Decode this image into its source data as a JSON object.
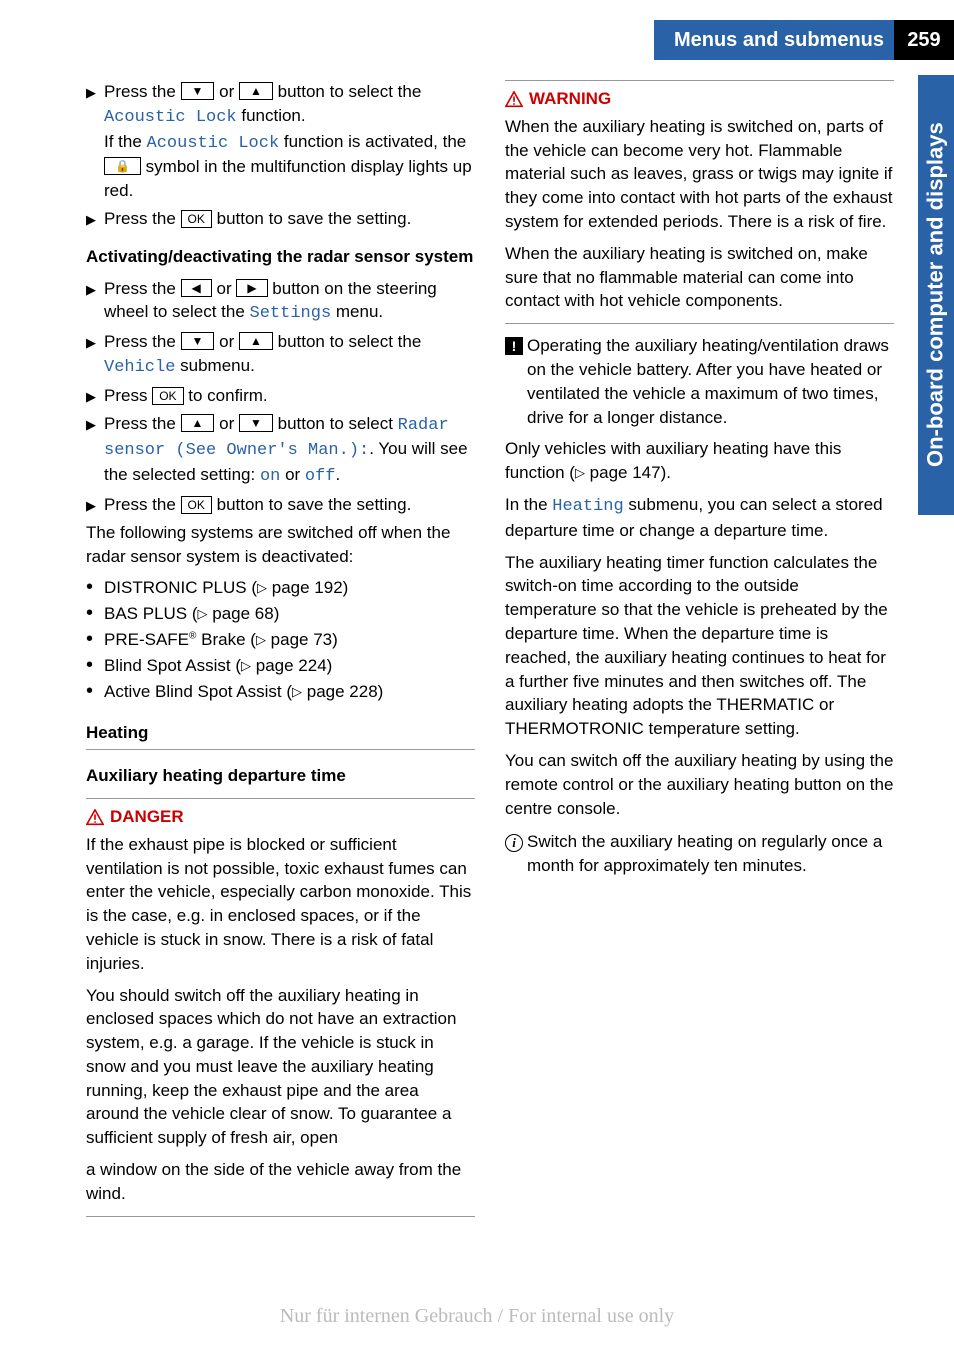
{
  "header": {
    "title": "Menus and submenus",
    "page": "259"
  },
  "sideTab": "On-board computer and displays",
  "buttons": {
    "down": "▼",
    "up": "▲",
    "left": "◀",
    "right": "▶",
    "ok": "OK",
    "lock": "🔒"
  },
  "mono": {
    "acousticLock": "Acoustic Lock",
    "settings": "Settings",
    "vehicle": "Vehicle",
    "radarSensor": "Radar sensor (See Owner's Man.):",
    "on": "on",
    "off": "off",
    "heating": "Heating"
  },
  "left": {
    "s1a": "Press the ",
    "s1b": " or ",
    "s1c": " button to select the ",
    "s1d": " function.",
    "s2a": "If the ",
    "s2b": " function is activated, the ",
    "s2c": " symbol in the multifunction display lights up red.",
    "s3a": "Press the ",
    "s3b": " button to save the setting.",
    "radarHeading": "Activating/deactivating the radar sensor system",
    "r1a": "Press the ",
    "r1b": " or ",
    "r1c": " button on the steering wheel to select the ",
    "r1d": " menu.",
    "r2a": "Press the ",
    "r2b": " or ",
    "r2c": " button to select the ",
    "r2d": " submenu.",
    "r3a": "Press ",
    "r3b": " to confirm.",
    "r4a": "Press the ",
    "r4b": " or ",
    "r4c": " button to select ",
    "r4d": ". You will see the selected setting: ",
    "r4e": " or ",
    "r4f": ".",
    "r5a": "Press the ",
    "r5b": " button to save the setting.",
    "followPara": "The following systems are switched off when the radar sensor system is deactivated:",
    "b1a": "DISTRONIC PLUS (",
    "b1b": " page 192)",
    "b2a": "BAS PLUS (",
    "b2b": " page 68)",
    "b3a": "PRE-SAFE",
    "b3r": "®",
    "b3b": " Brake (",
    "b3c": " page 73)",
    "b4a": "Blind Spot Assist (",
    "b4b": " page 224)",
    "b5a": "Active Blind Spot Assist (",
    "b5b": " page 228)",
    "heatingHeading": "Heating",
    "auxHeading": "Auxiliary heating departure time",
    "dangerLabel": "DANGER",
    "dangerP1": "If the exhaust pipe is blocked or sufficient ventilation is not possible, toxic exhaust fumes can enter the vehicle, especially carbon monoxide. This is the case, e.g. in enclosed spaces, or if the vehicle is stuck in snow. There is a risk of fatal injuries.",
    "dangerP2": "You should switch off the auxiliary heating in enclosed spaces which do not have an extraction system, e.g. a garage. If the vehicle is stuck in snow and you must leave the auxiliary heating running, keep the exhaust pipe and the area around the vehicle clear of snow. To guarantee a sufficient supply of fresh air, open"
  },
  "right": {
    "cont": "a window on the side of the vehicle away from the wind.",
    "warningLabel": "WARNING",
    "warnP1": "When the auxiliary heating is switched on, parts of the vehicle can become very hot. Flammable material such as leaves, grass or twigs may ignite if they come into contact with hot parts of the exhaust system for extended periods. There is a risk of fire.",
    "warnP2": "When the auxiliary heating is switched on, make sure that no flammable material can come into contact with hot vehicle components.",
    "notice1": "Operating the auxiliary heating/ventilation draws on the vehicle battery. After you have heated or ventilated the vehicle a maximum of two times, drive for a longer distance.",
    "p1a": "Only vehicles with auxiliary heating have this function (",
    "p1b": " page 147).",
    "p2a": "In the ",
    "p2b": " submenu, you can select a stored departure time or change a departure time.",
    "p3": "The auxiliary heating timer function calculates the switch-on time according to the outside temperature so that the vehicle is preheated by the departure time. When the departure time is reached, the auxiliary heating continues to heat for a further five minutes and then switches off. The auxiliary heating adopts the THERMATIC or THERMOTRONIC temperature setting.",
    "p4": "You can switch off the auxiliary heating by using the remote control or the auxiliary heating button on the centre console.",
    "info1": "Switch the auxiliary heating on regularly once a month for approximately ten minutes."
  },
  "watermark": "Nur für internen Gebrauch / For internal use only",
  "pageRef": "▷"
}
